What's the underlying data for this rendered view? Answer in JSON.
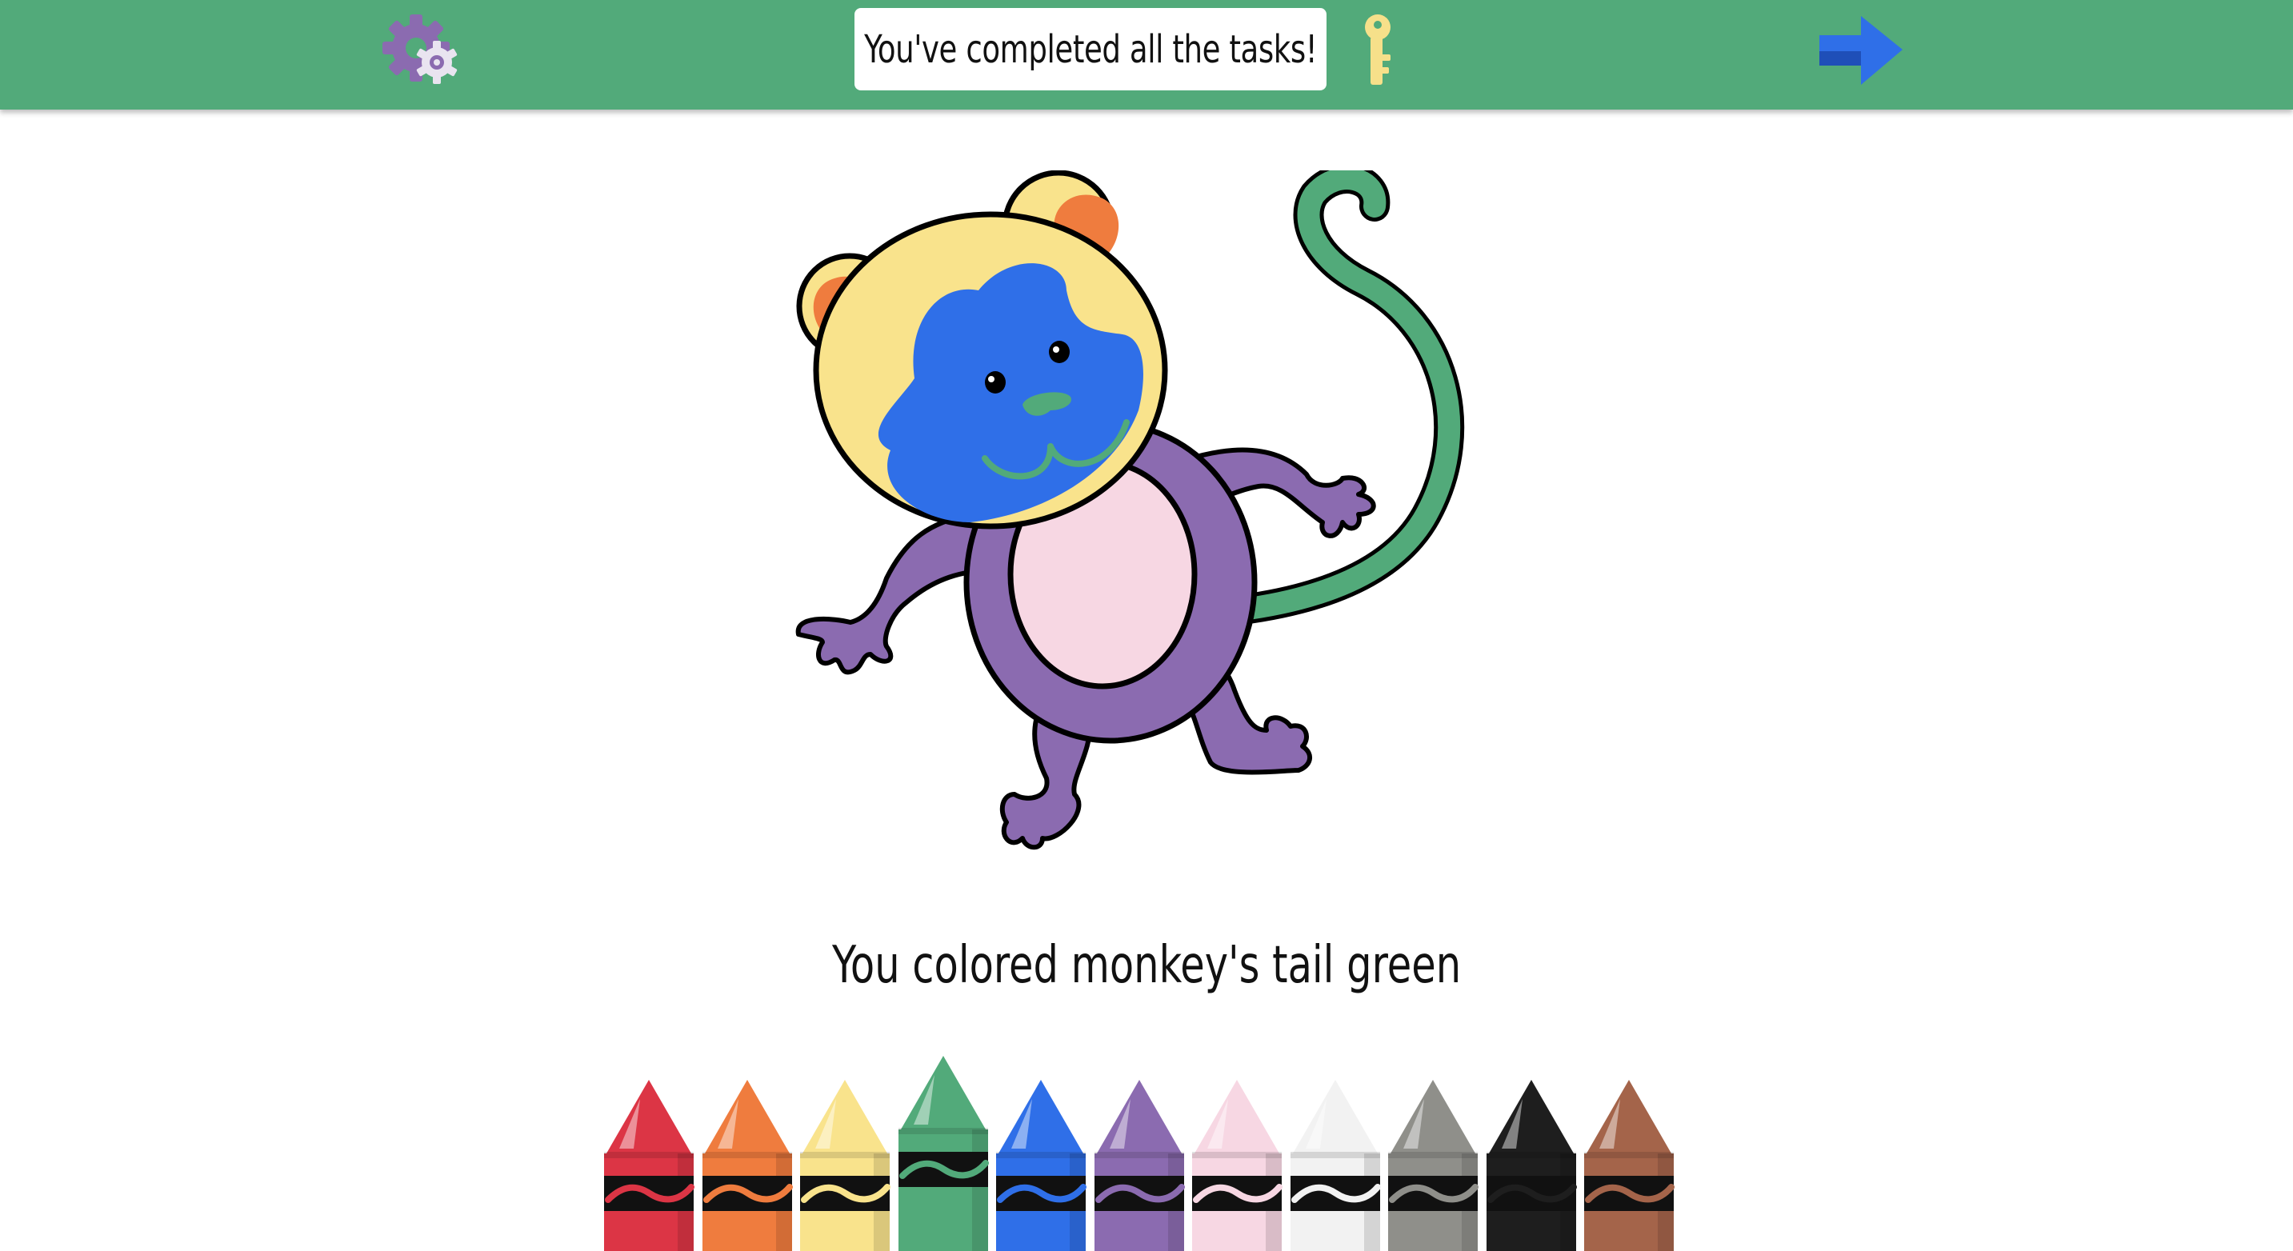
{
  "header": {
    "status_text": "You've completed all the tasks!",
    "settings_icon": "gear-icon",
    "key_icon": "key-icon",
    "next_icon": "arrow-right-icon",
    "background_color": "#52aa7a"
  },
  "main": {
    "message": "You colored monkey's tail green",
    "picture_subject": "monkey"
  },
  "palette": {
    "crayons": [
      {
        "name": "red",
        "color": "#dc3545",
        "selected": false
      },
      {
        "name": "orange",
        "color": "#ef7c3e",
        "selected": false
      },
      {
        "name": "yellow",
        "color": "#f9e38c",
        "selected": false
      },
      {
        "name": "green",
        "color": "#52aa7a",
        "selected": true
      },
      {
        "name": "blue",
        "color": "#2f6fe8",
        "selected": false
      },
      {
        "name": "purple",
        "color": "#8b6bb0",
        "selected": false
      },
      {
        "name": "pink",
        "color": "#f7d7e3",
        "selected": false
      },
      {
        "name": "white",
        "color": "#f2f2f2",
        "selected": false
      },
      {
        "name": "gray",
        "color": "#8f8f8a",
        "selected": false
      },
      {
        "name": "black",
        "color": "#1e1e1e",
        "selected": false
      },
      {
        "name": "brown",
        "color": "#a4644a",
        "selected": false
      }
    ]
  },
  "monkey_colors": {
    "head": "#f9e38c",
    "face": "#2f6fe8",
    "ears_inner": "#ef7c3e",
    "body": "#8b6bb0",
    "belly": "#f7d7e3",
    "tail": "#52aa7a",
    "nose_mouth": "#52aa7a",
    "outline": "#000000"
  }
}
